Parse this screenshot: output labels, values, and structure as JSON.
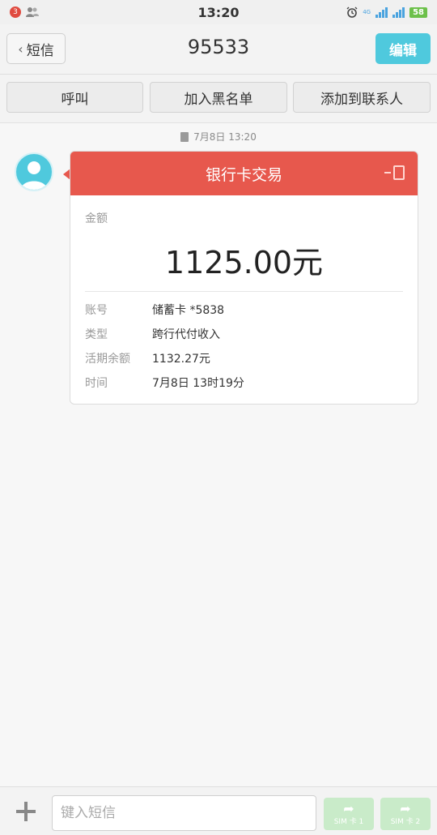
{
  "status_bar": {
    "time": "13:20",
    "notification_count": "3",
    "network": "4G",
    "battery": "58"
  },
  "header": {
    "back_label": "短信",
    "title": "95533",
    "edit_label": "编辑"
  },
  "actions": {
    "call": "呼叫",
    "blacklist": "加入黑名单",
    "add_contact": "添加到联系人"
  },
  "message": {
    "date": "7月8日 13:20",
    "card_title": "银行卡交易",
    "amount_label": "金额",
    "amount": "1125.00元",
    "details": [
      {
        "label": "账号",
        "value": "储蓄卡 *5838"
      },
      {
        "label": "类型",
        "value": "跨行代付收入"
      },
      {
        "label": "活期余额",
        "value": "1132.27元"
      },
      {
        "label": "时间",
        "value": "7月8日 13时19分"
      }
    ]
  },
  "composer": {
    "placeholder": "键入短信",
    "sim1": "SIM 卡 1",
    "sim2": "SIM 卡 2"
  },
  "colors": {
    "accent": "#4fc9dd",
    "card_header": "#e7584d",
    "send_disabled": "#c9ebc9"
  }
}
